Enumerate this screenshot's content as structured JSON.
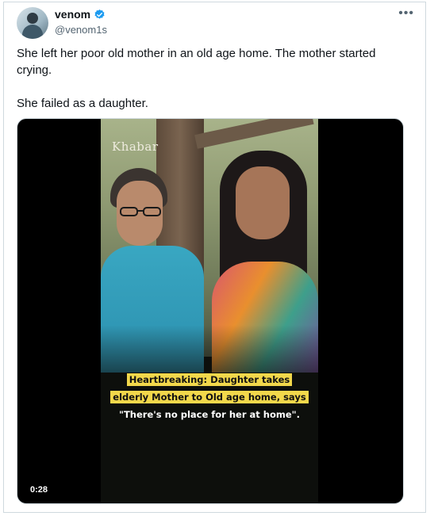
{
  "tweet": {
    "author": {
      "display_name": "venom",
      "handle": "@venom1s",
      "verified": true,
      "avatar_icon": "profile-avatar"
    },
    "more_icon": "ellipsis-icon",
    "text_line_1": "She left her poor old mother in an old age home. The mother started crying.",
    "text_line_2": "She failed as a daughter."
  },
  "media": {
    "watermark": "Khabar",
    "caption_line_1": "Heartbreaking: Daughter takes",
    "caption_line_2": "elderly Mother to Old age home, says",
    "caption_line_3": "\"There's no place for her at home\".",
    "duration": "0:28"
  },
  "colors": {
    "verified_badge": "#1d9bf0",
    "caption_highlight": "#f2d84b",
    "handle_text": "#536471"
  }
}
